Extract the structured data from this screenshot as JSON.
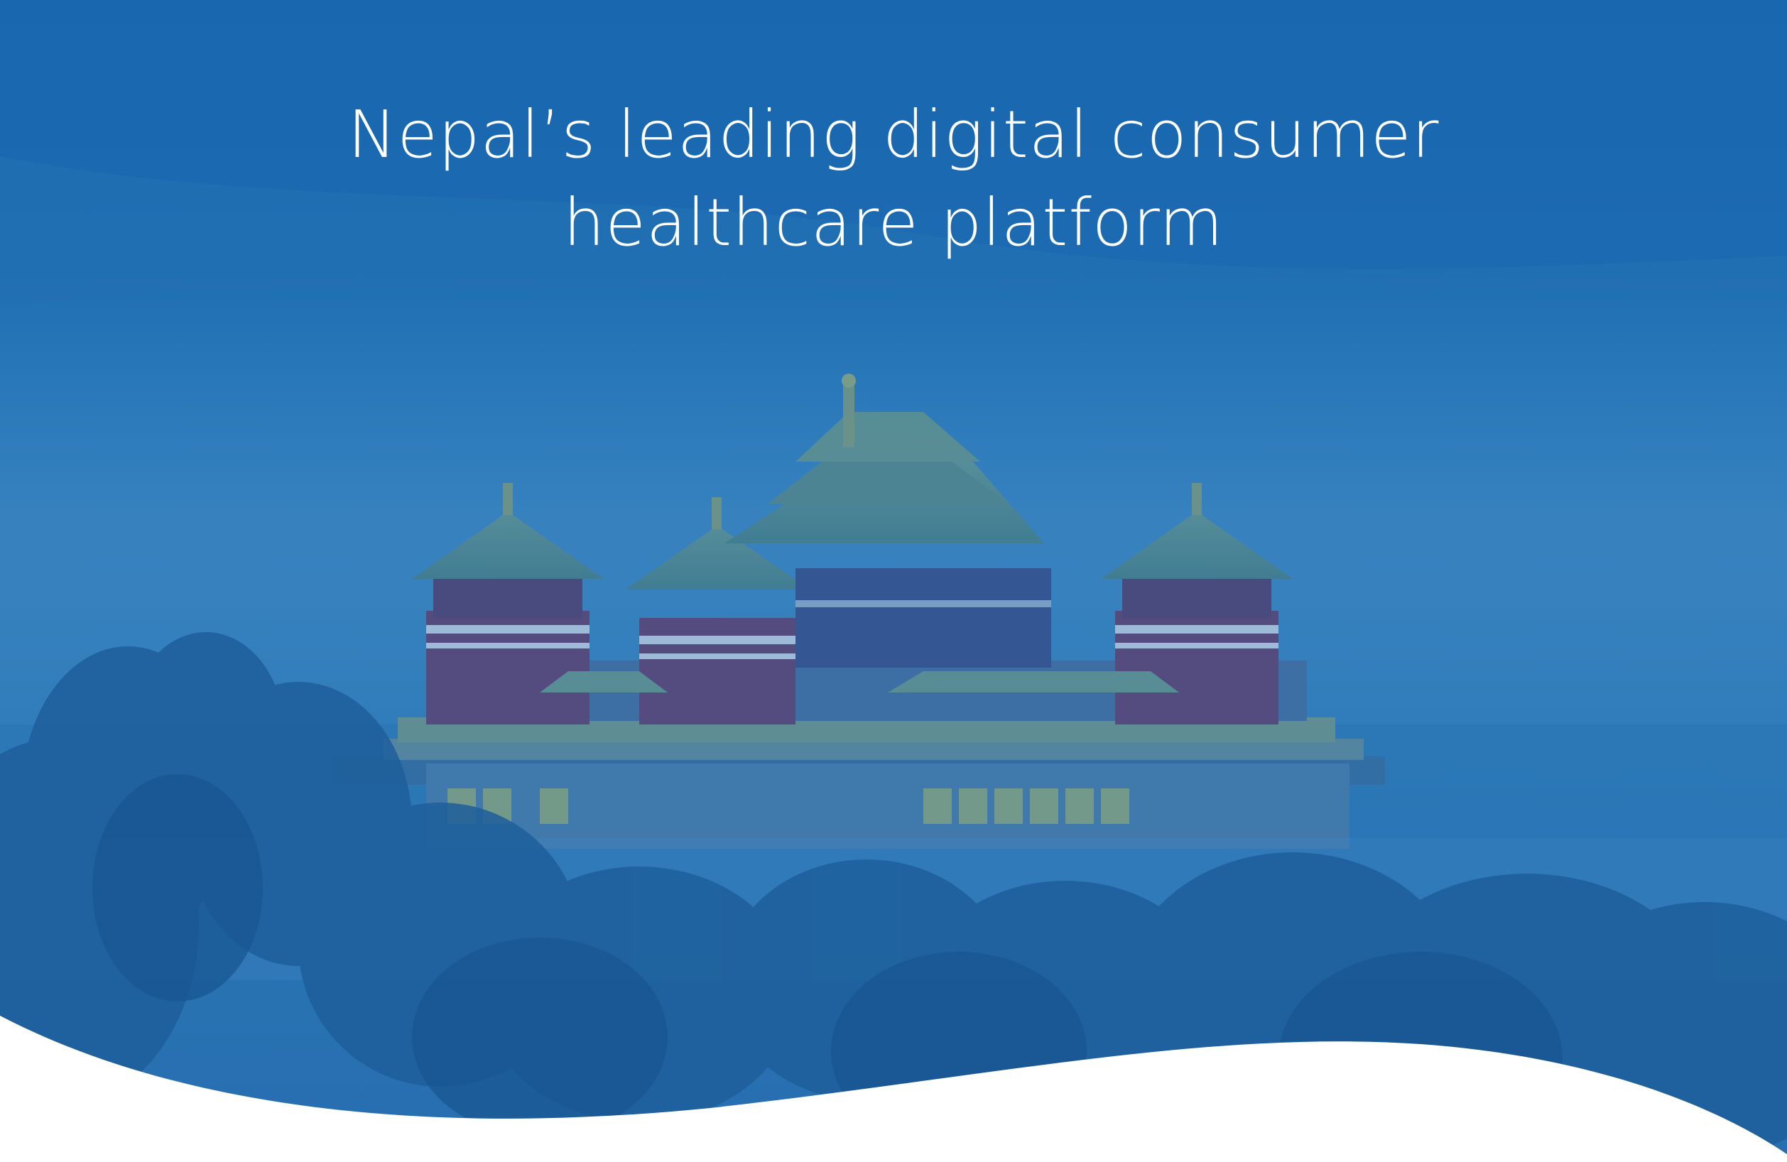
{
  "hero": {
    "headline_line1": "Nepal’s leading digital consumer",
    "headline_line2": "healthcare platform",
    "background_description_icon": "monastery-in-fog-image",
    "overlay_color": "#1a6db3",
    "wave_color": "#ffffff"
  }
}
